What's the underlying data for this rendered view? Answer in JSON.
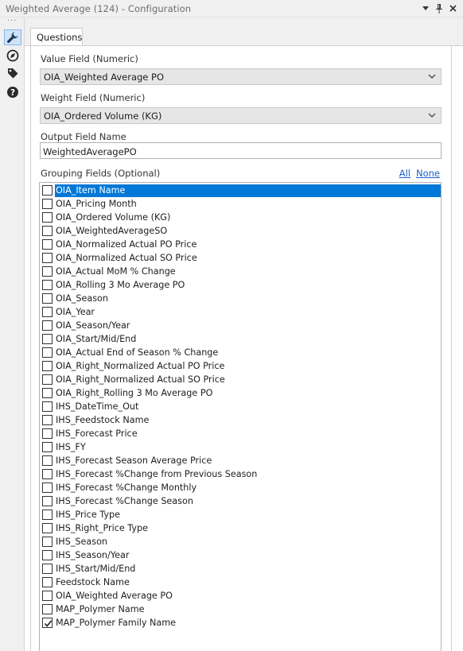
{
  "window": {
    "title": "Weighted Average (124) - Configuration",
    "controls": [
      "dropdown-arrow",
      "pin",
      "close"
    ]
  },
  "toolrail": {
    "icons": [
      "wrench-icon",
      "compass-icon",
      "tag-icon",
      "help-icon"
    ],
    "active": "wrench-icon"
  },
  "tabs": [
    {
      "label": "Questions",
      "active": true
    }
  ],
  "form": {
    "value_field": {
      "label": "Value Field (Numeric)",
      "selected": "OIA_Weighted Average PO"
    },
    "weight_field": {
      "label": "Weight Field (Numeric)",
      "selected": "OIA_Ordered Volume (KG)"
    },
    "output_field": {
      "label": "Output Field Name",
      "value": "WeightedAveragePO"
    },
    "grouping": {
      "label": "Grouping Fields (Optional)",
      "all_link": "All",
      "none_link": "None",
      "items": [
        {
          "name": "OIA_Item Name",
          "checked": false,
          "selected": true
        },
        {
          "name": "OIA_Pricing Month",
          "checked": false
        },
        {
          "name": "OIA_Ordered Volume (KG)",
          "checked": false
        },
        {
          "name": "OIA_WeightedAverageSO",
          "checked": false
        },
        {
          "name": "OIA_Normalized Actual PO Price",
          "checked": false
        },
        {
          "name": "OIA_Normalized Actual SO Price",
          "checked": false
        },
        {
          "name": "OIA_Actual MoM % Change",
          "checked": false
        },
        {
          "name": "OIA_Rolling 3 Mo Average PO",
          "checked": false
        },
        {
          "name": "OIA_Season",
          "checked": false
        },
        {
          "name": "OIA_Year",
          "checked": false
        },
        {
          "name": "OIA_Season/Year",
          "checked": false
        },
        {
          "name": "OIA_Start/Mid/End",
          "checked": false
        },
        {
          "name": "OIA_Actual End of Season % Change",
          "checked": false
        },
        {
          "name": "OIA_Right_Normalized Actual PO Price",
          "checked": false
        },
        {
          "name": "OIA_Right_Normalized Actual SO Price",
          "checked": false
        },
        {
          "name": "OIA_Right_Rolling 3 Mo Average PO",
          "checked": false
        },
        {
          "name": "IHS_DateTime_Out",
          "checked": false
        },
        {
          "name": "IHS_Feedstock Name",
          "checked": false
        },
        {
          "name": "IHS_Forecast Price",
          "checked": false
        },
        {
          "name": "IHS_FY",
          "checked": false
        },
        {
          "name": "IHS_Forecast Season Average Price",
          "checked": false
        },
        {
          "name": "IHS_Forecast %Change from Previous Season",
          "checked": false
        },
        {
          "name": "IHS_Forecast %Change Monthly",
          "checked": false
        },
        {
          "name": "IHS_Forecast %Change Season",
          "checked": false
        },
        {
          "name": "IHS_Price Type",
          "checked": false
        },
        {
          "name": "IHS_Right_Price Type",
          "checked": false
        },
        {
          "name": "IHS_Season",
          "checked": false
        },
        {
          "name": "IHS_Season/Year",
          "checked": false
        },
        {
          "name": "IHS_Start/Mid/End",
          "checked": false
        },
        {
          "name": "Feedstock Name",
          "checked": false
        },
        {
          "name": "OIA_Weighted Average PO",
          "checked": false
        },
        {
          "name": "MAP_Polymer Name",
          "checked": false
        },
        {
          "name": "MAP_Polymer Family Name",
          "checked": true
        }
      ]
    }
  }
}
